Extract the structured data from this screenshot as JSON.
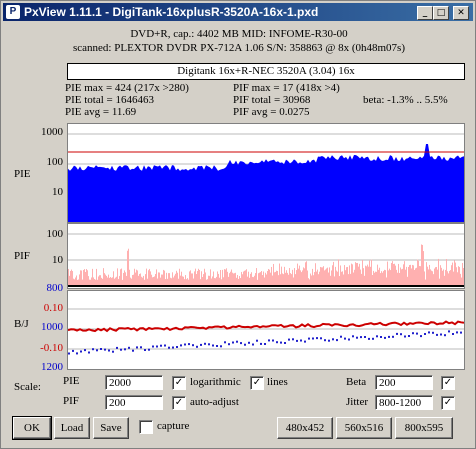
{
  "window": {
    "title": "PxView 1.11.1  -  DigiTank-16xplusR-3520A-16x-1.pxd",
    "minimize_glyph": "_",
    "restore_glyph": "□",
    "close_glyph": "✕",
    "app_icon_glyph": "P"
  },
  "header": {
    "line1": "DVD+R, cap.: 4402 MB MID: INFOME-R30-00",
    "line2": "scanned: PLEXTOR DVDR PX-712A 1.06 S/N: 358863 @ 8x (0h48m07s)",
    "drive_label": "Digitank 16x+R-NEC 3520A (3.04) 16x"
  },
  "stats": {
    "pie_max": "PIE max = 424 (217x >280)",
    "pie_total": "PIE total = 1646463",
    "pie_avg": "PIE avg = 11.69",
    "pif_max": "PIF max = 17 (418x >4)",
    "pif_total": "PIF total = 30968",
    "pif_avg": "PIF avg = 0.0275",
    "beta": "beta: -1.3% .. 5.5%"
  },
  "graphs": {
    "pie": {
      "name": "PIE",
      "ticks": [
        "1000",
        "100",
        "10"
      ]
    },
    "pif": {
      "name": "PIF",
      "ticks": [
        "100",
        "10",
        "800"
      ]
    },
    "bj": {
      "name": "B/J",
      "ticks": [
        "0.10",
        "1000",
        "-0.10",
        "1200"
      ]
    }
  },
  "controls": {
    "scale_label": "Scale:",
    "pie_label": "PIE",
    "pif_label": "PIF",
    "pie_value": "2000",
    "pif_value": "200",
    "logarithmic_label": "logarithmic",
    "lines_label": "lines",
    "auto_adjust_label": "auto-adjust",
    "beta_label": "Beta",
    "beta_value": "200",
    "jitter_label": "Jitter",
    "jitter_value": "800-1200",
    "capture_label": "capture",
    "check_glyph": "✓",
    "logarithmic_checked": true,
    "lines_checked": true,
    "auto_adjust_checked": true,
    "beta_checked": true,
    "jitter_checked": true,
    "capture_checked": false
  },
  "buttons": {
    "ok": "OK",
    "load": "Load",
    "save": "Save",
    "size1": "480x452",
    "size2": "560x516",
    "size3": "800x595"
  },
  "colors": {
    "pie_fill": "#0000ff",
    "pif_fill": "#ff9999",
    "beta_line": "#cc0000",
    "jitter_dots": "#2020cc",
    "threshold_line": "#cc0000",
    "title_bar": "#0a246a"
  }
}
